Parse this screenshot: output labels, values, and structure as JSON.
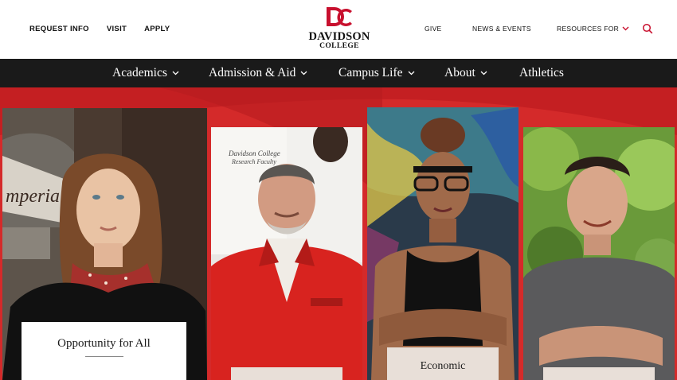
{
  "header": {
    "util_left": [
      "REQUEST INFO",
      "VISIT",
      "APPLY"
    ],
    "logo": {
      "monogram": "DC",
      "name": "DAVIDSON",
      "sub": "COLLEGE"
    },
    "util_right": {
      "give": "GIVE",
      "news": "NEWS & EVENTS",
      "resources": "RESOURCES FOR"
    }
  },
  "nav": {
    "academics": "Academics",
    "admission": "Admission & Aid",
    "campus": "Campus Life",
    "about": "About",
    "athletics": "Athletics"
  },
  "hero": {
    "cards": [
      {
        "caption": "Opportunity for All"
      },
      {
        "caption": ""
      },
      {
        "caption": "Economic"
      },
      {
        "caption": ""
      }
    ]
  },
  "colors": {
    "brand_red": "#d42a2a",
    "nav_bg": "#1a1a1a",
    "accent": "#c8102e"
  }
}
